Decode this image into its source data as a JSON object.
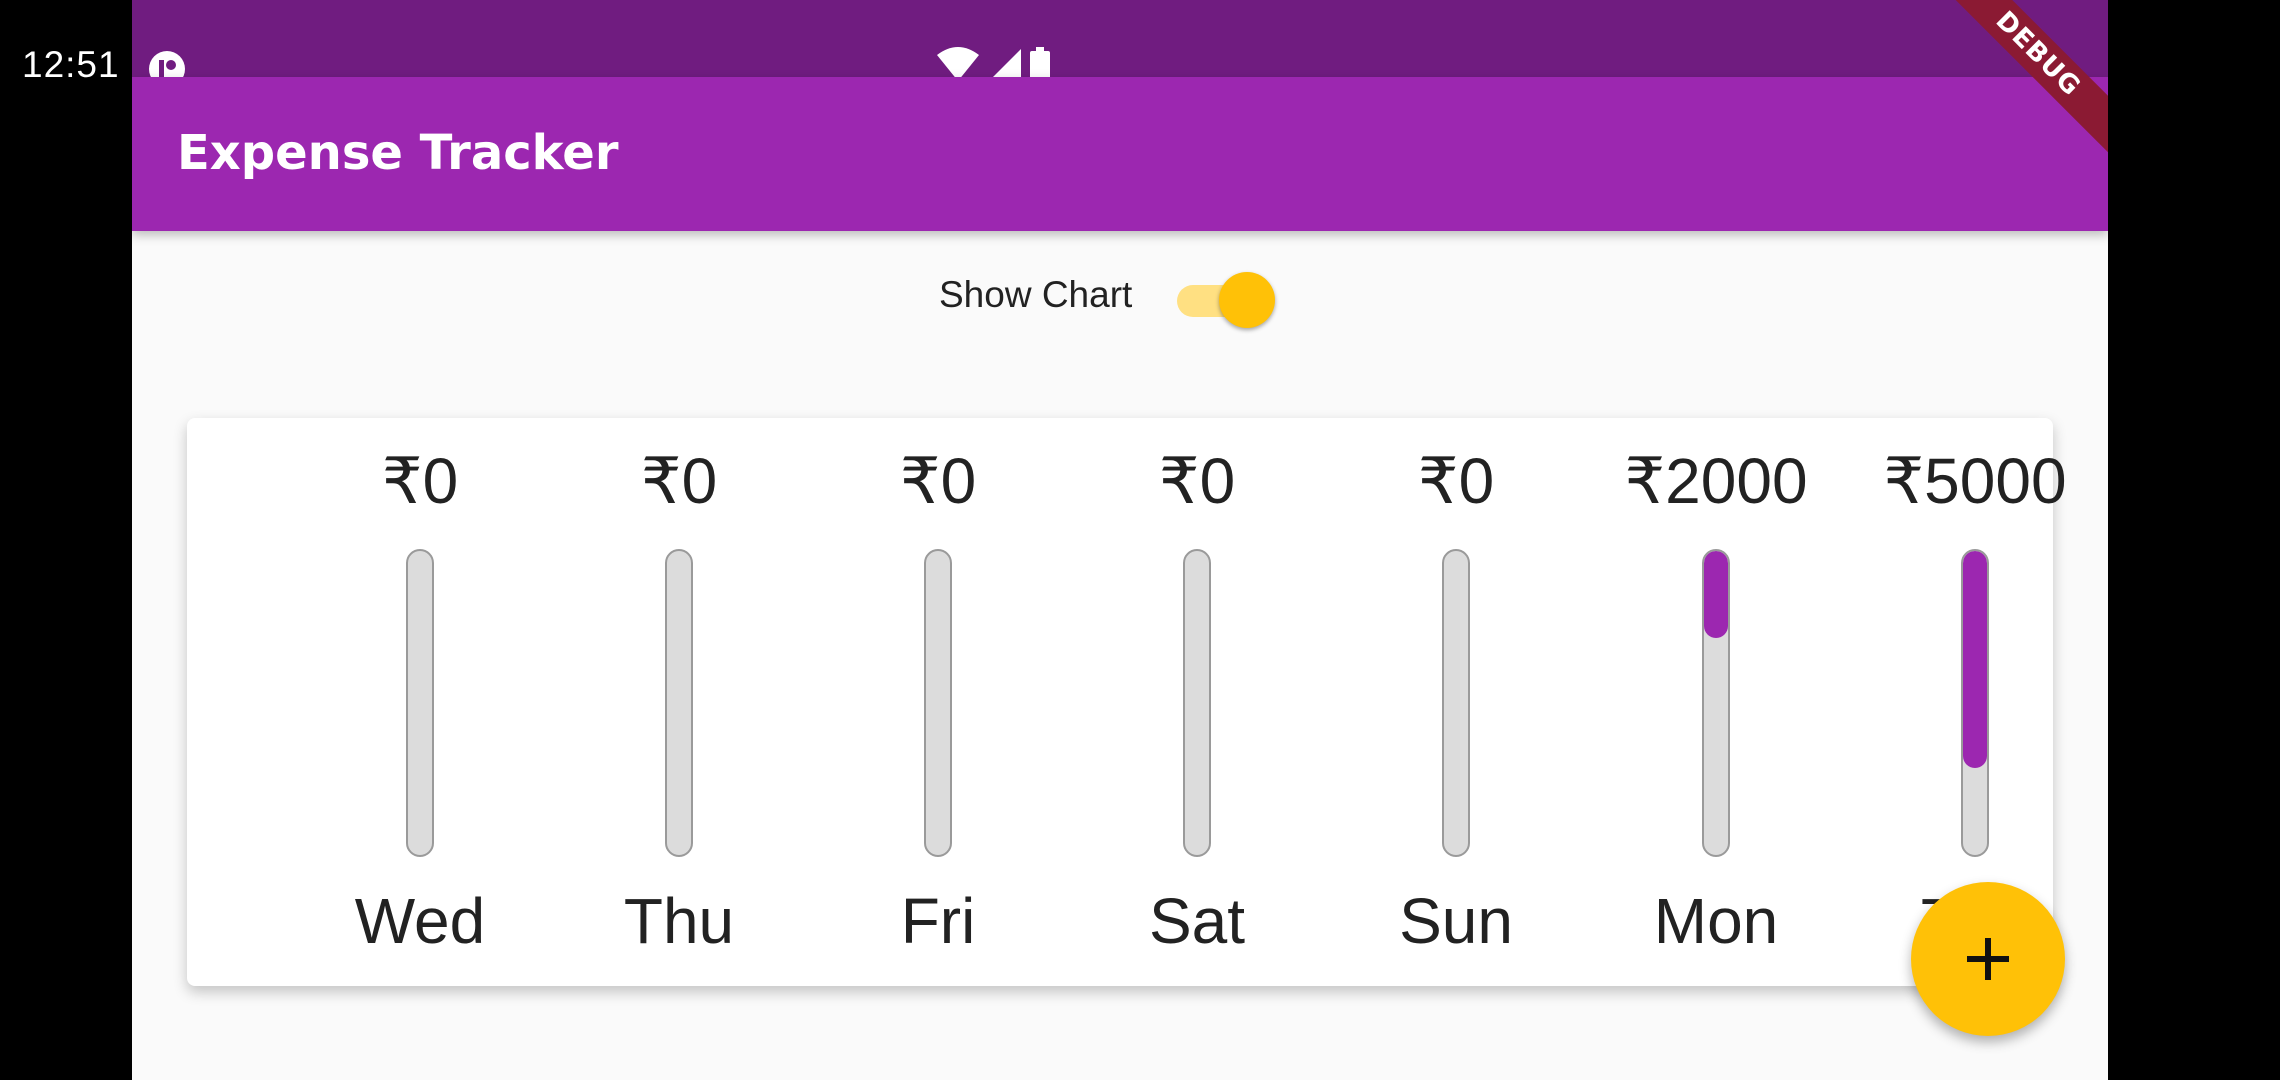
{
  "status_bar": {
    "time": "12:51",
    "icons": [
      "notification-app-icon",
      "wifi-icon",
      "signal-icon",
      "battery-icon"
    ],
    "background": "#701c80"
  },
  "app_bar": {
    "title": "Expense Tracker",
    "background": "#9c27b0",
    "debug_banner": "DEBUG"
  },
  "toggle": {
    "label": "Show Chart",
    "value": true,
    "accent": "#ffc107"
  },
  "chart_data": {
    "type": "bar",
    "categories": [
      "Wed",
      "Thu",
      "Fri",
      "Sat",
      "Sun",
      "Mon",
      "Tue"
    ],
    "value_labels": [
      "₹0",
      "₹0",
      "₹0",
      "₹0",
      "₹0",
      "₹2000",
      "₹5000"
    ],
    "values": [
      0,
      0,
      0,
      0,
      0,
      2000,
      5000
    ],
    "fill_fraction": [
      0,
      0,
      0,
      0,
      0,
      0.286,
      0.714
    ],
    "bar_color": "#9c27b0",
    "track_color": "#dcdcdc"
  },
  "fab": {
    "icon": "add-icon",
    "color": "#ffc107"
  }
}
